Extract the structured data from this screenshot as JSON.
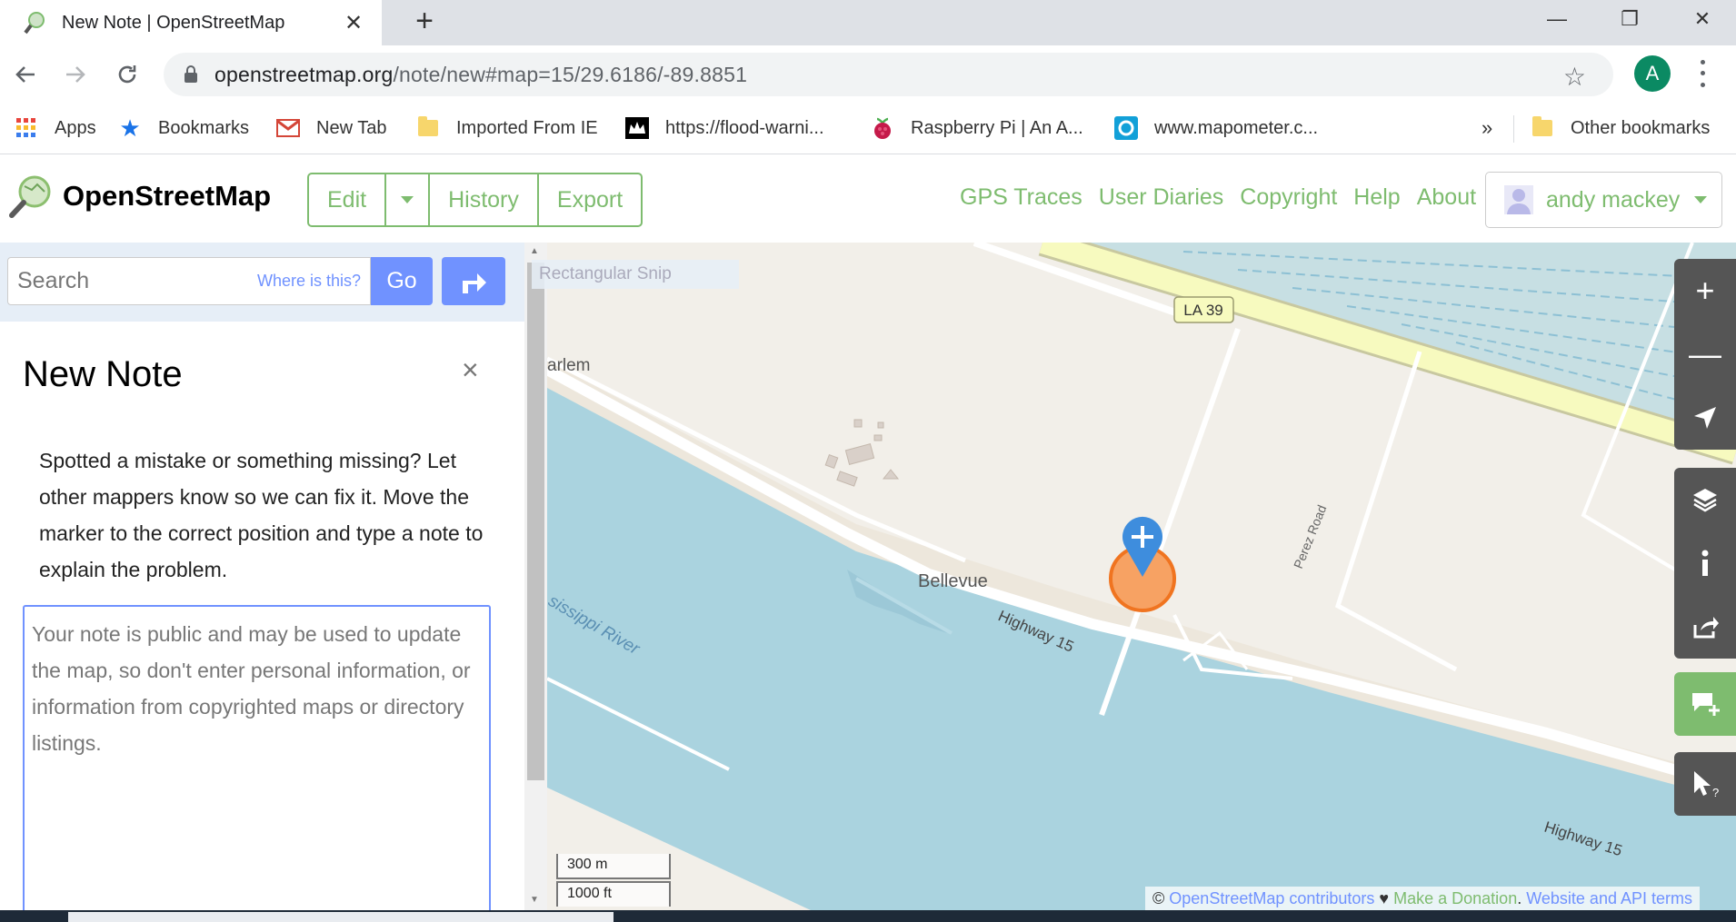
{
  "browser": {
    "tab_title": "New Note | OpenStreetMap",
    "url_host": "openstreetmap.org",
    "url_path": "/note/new#map=15/29.6186/-89.8851",
    "profile_initial": "A",
    "bookmarks": [
      {
        "label": "Apps",
        "icon": "apps-grid-icon"
      },
      {
        "label": "Bookmarks",
        "icon": "star-icon"
      },
      {
        "label": "New Tab",
        "icon": "gmail-icon"
      },
      {
        "label": "Imported From IE",
        "icon": "folder-icon"
      },
      {
        "label": "https://flood-warni...",
        "icon": "crown-icon"
      },
      {
        "label": "Raspberry Pi | An A...",
        "icon": "raspberry-icon"
      },
      {
        "label": "www.mapometer.c...",
        "icon": "mapometer-icon"
      }
    ],
    "overflow": "»",
    "other_bookmarks": "Other bookmarks"
  },
  "osm": {
    "brand": "OpenStreetMap",
    "edit": "Edit",
    "history": "History",
    "export": "Export",
    "links": [
      "GPS Traces",
      "User Diaries",
      "Copyright",
      "Help",
      "About"
    ],
    "user": "andy mackey",
    "brand_color": "#7ebc6f",
    "accent_color": "#7092ff"
  },
  "sidebar": {
    "search_placeholder": "Search",
    "where_is_this": "Where is this?",
    "go": "Go",
    "note_title": "New Note",
    "close": "×",
    "description": "Spotted a mistake or something missing? Let other mappers know so we can fix it. Move the marker to the correct position and type a note to explain the problem.",
    "textarea_placeholder": "Your note is public and may be used to update the map, so don't enter personal information, or information from copyrighted maps or directory listings."
  },
  "map": {
    "labels": {
      "la39": "LA 39",
      "harlem": "arlem",
      "bellevue": "Bellevue",
      "highway15_a": "Highway 15",
      "highway15_b": "Highway 15",
      "perez": "Perez Road",
      "river": "sissippi River"
    },
    "scale_metric": "300 m",
    "scale_imperial": "1000 ft",
    "attribution_copy": "©",
    "attribution_contributors": "OpenStreetMap contributors",
    "attribution_heart": "♥",
    "attribution_donate": "Make a Donation",
    "attribution_terms": "Website and API terms",
    "snip_overlay": "Rectangular Snip"
  }
}
